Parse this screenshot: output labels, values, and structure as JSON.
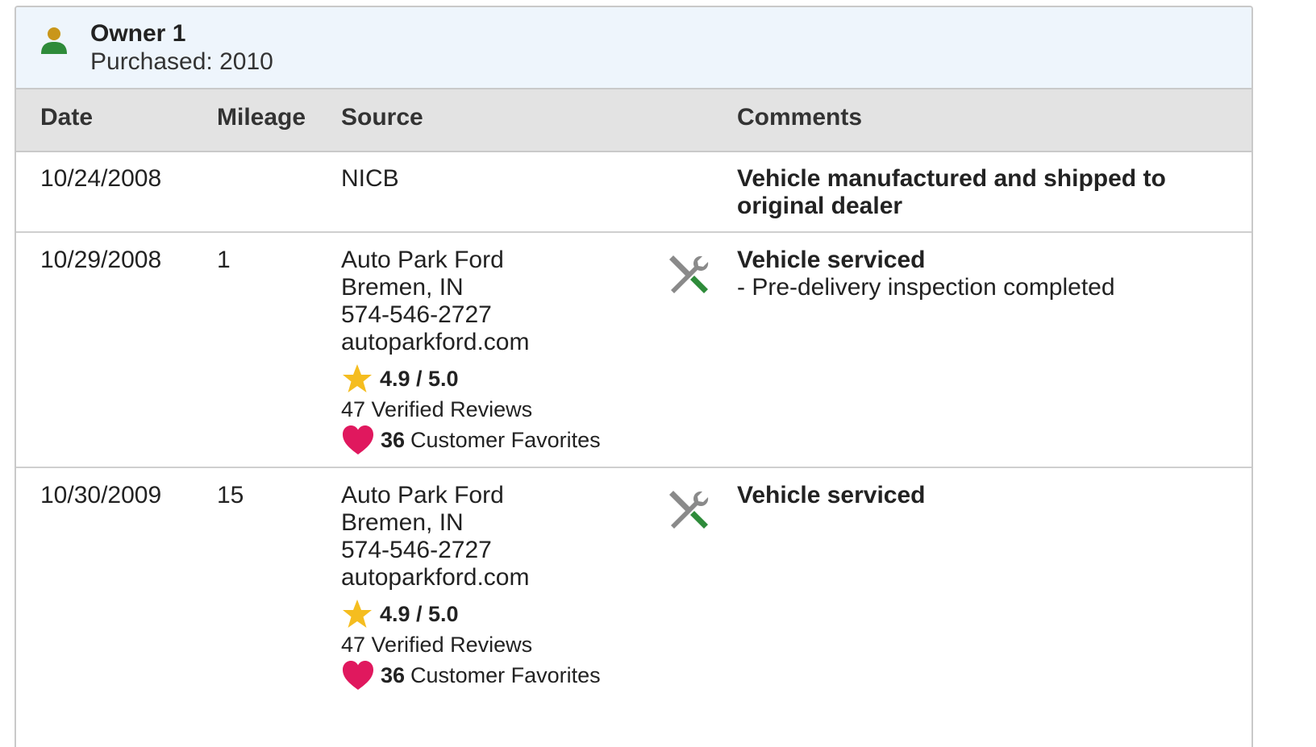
{
  "owner": {
    "name": "Owner 1",
    "purchased": "Purchased: 2010"
  },
  "columns": {
    "date": "Date",
    "mileage": "Mileage",
    "source": "Source",
    "comments": "Comments"
  },
  "rows": [
    {
      "date": "10/24/2008",
      "mileage": "",
      "source": {
        "name": "NICB"
      },
      "comment_title": "Vehicle manufactured and shipped to original dealer"
    },
    {
      "date": "10/29/2008",
      "mileage": "1",
      "source": {
        "name": "Auto Park Ford",
        "location": "Bremen, IN",
        "phone": "574-546-2727",
        "website": "autoparkford.com",
        "rating": "4.9 / 5.0",
        "reviews": "47 Verified Reviews",
        "favorites_count": "36",
        "favorites_label": "Customer Favorites"
      },
      "icon": "service-tools-icon",
      "comment_title": "Vehicle serviced",
      "comment_detail": "- Pre-delivery inspection completed"
    },
    {
      "date": "10/30/2009",
      "mileage": "15",
      "source": {
        "name": "Auto Park Ford",
        "location": "Bremen, IN",
        "phone": "574-546-2727",
        "website": "autoparkford.com",
        "rating": "4.9 / 5.0",
        "reviews": "47 Verified Reviews",
        "favorites_count": "36",
        "favorites_label": "Customer Favorites"
      },
      "icon": "service-tools-icon",
      "comment_title": "Vehicle serviced"
    }
  ],
  "icons": {
    "owner": "person-icon",
    "rating": "star-icon",
    "favorites": "heart-icon"
  },
  "colors": {
    "header_bg": "#eef5fc",
    "table_head_bg": "#e3e3e3",
    "person_head": "#c9961a",
    "person_body": "#2e8b3a",
    "star": "#f5bd1f",
    "heart": "#e0185e",
    "tool_grey": "#8a8a8a",
    "tool_green": "#2e8b3a"
  }
}
